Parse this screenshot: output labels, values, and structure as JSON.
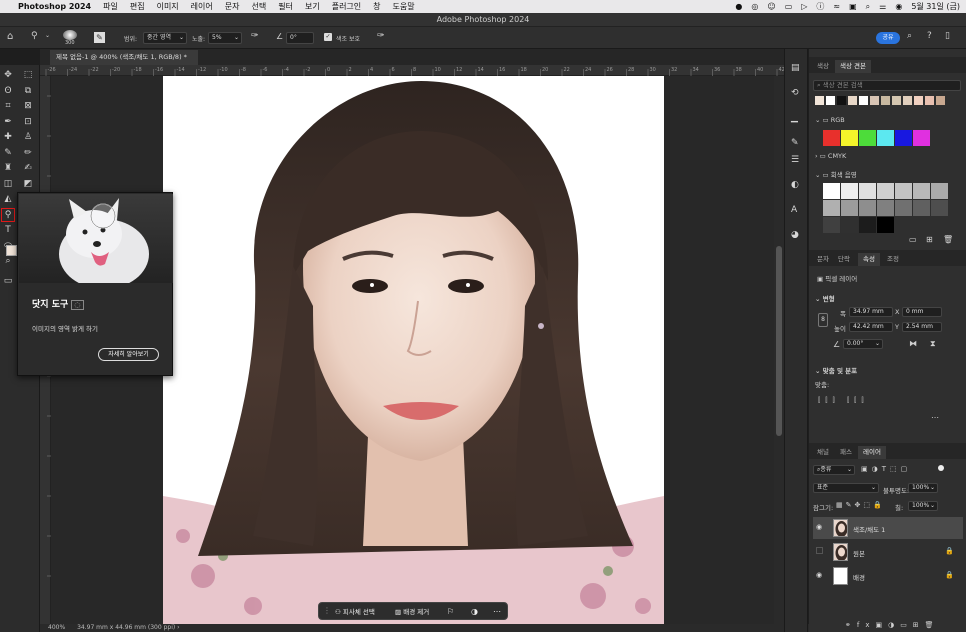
{
  "menubar": {
    "app": "Photoshop 2024",
    "items": [
      "파일",
      "편집",
      "이미지",
      "레이어",
      "문자",
      "선택",
      "필터",
      "보기",
      "플러그인",
      "창",
      "도움말"
    ],
    "clock": "5월 31일 (금)"
  },
  "window": {
    "title": "Adobe Photoshop 2024"
  },
  "options": {
    "brush_size": "300",
    "range_label": "범위:",
    "range_value": "중간 영역",
    "exposure_label": "노출:",
    "exposure_value": "5%",
    "angle_value": "0°",
    "protect_label": "색조 보호",
    "share_label": "공유"
  },
  "document": {
    "tab_title": "제목 없음-1 @ 400% (색조/채도 1, RGB/8) *"
  },
  "ruler_ticks": [
    "-26",
    "-24",
    "-22",
    "-20",
    "-18",
    "-16",
    "-14",
    "-12",
    "-10",
    "-8",
    "-6",
    "-4",
    "-2",
    "0",
    "2",
    "4",
    "6",
    "8",
    "10",
    "12",
    "14",
    "16",
    "18",
    "20",
    "22",
    "24",
    "26",
    "28",
    "30",
    "32",
    "34",
    "36",
    "38",
    "40",
    "42"
  ],
  "status": {
    "zoom": "400%",
    "info": "34.97 mm x 44.96 mm (300 ppi)"
  },
  "tooltip": {
    "title": "닷지 도구",
    "description": "이미지의 영역 밝게 하기",
    "button": "자세히 알아보기"
  },
  "floating_bar": {
    "select_subject": "피사체 선택",
    "remove_bg": "배경 제거"
  },
  "swatches_panel": {
    "tabs": [
      "색상",
      "색상 견본"
    ],
    "search_placeholder": "색상 견본 검색",
    "recent": [
      "#f1e4d8",
      "#ffffff",
      "#111111",
      "#e8d8c8",
      "#ffffff",
      "#d8c4b4",
      "#c8b8a0",
      "#d4c6b0",
      "#e0cebc",
      "#f0d0c0",
      "#e8c0b0",
      "#c8a890"
    ],
    "groups": [
      {
        "name": "RGB",
        "colors": [
          "#e8302c",
          "#f4f42a",
          "#4ddc3a",
          "#5ce8f0",
          "#1818e0",
          "#e030e0"
        ]
      },
      {
        "name": "CMYK"
      },
      {
        "name": "회색 음영",
        "colors": [
          "#ffffff",
          "#efefef",
          "#e0e0e0",
          "#d0d0d0",
          "#c4c4c4",
          "#b8b8b8",
          "#aaaaaa",
          "#b0b0b0",
          "#9c9c9c",
          "#8e8e8e",
          "#808080",
          "#707070",
          "#606060",
          "#4e4e4e",
          "#404040",
          "#303030",
          "#1c1c1c",
          "#000000"
        ]
      }
    ]
  },
  "properties_panel": {
    "tabs": [
      "문자",
      "단락",
      "속성",
      "조정"
    ],
    "layer_type": "픽셀 레이어",
    "transform_label": "변형",
    "w_label": "폭",
    "w_value": "34.97 mm",
    "h_label": "높이",
    "h_value": "42.42 mm",
    "x_label": "X",
    "x_value": "0 mm",
    "y_label": "Y",
    "y_value": "2.54 mm",
    "angle_value": "0.00°",
    "align_label": "맞춤 및 분포",
    "align_sub": "맞춤:"
  },
  "layers_panel": {
    "tabs": [
      "채널",
      "패스",
      "레이어"
    ],
    "filter": "종류",
    "blend_mode": "표준",
    "opacity_label": "불투명도:",
    "opacity_value": "100%",
    "lock_label": "잠그기:",
    "fill_label": "칠:",
    "fill_value": "100%",
    "layers": [
      {
        "name": "색조/채도 1",
        "selected": true
      },
      {
        "name": "원본",
        "selected": false
      },
      {
        "name": "배경",
        "selected": false
      }
    ]
  },
  "tools": [
    "move",
    "marquee",
    "lasso",
    "object-select",
    "crop",
    "frame",
    "eyedropper",
    "ruler",
    "healing",
    "patch",
    "brush",
    "pencil",
    "clone-stamp",
    "history-brush",
    "eraser",
    "bg-eraser",
    "gradient",
    "blur",
    "dodge",
    "pen",
    "type",
    "path-select",
    "shape",
    "hand",
    "zoom",
    "more"
  ]
}
